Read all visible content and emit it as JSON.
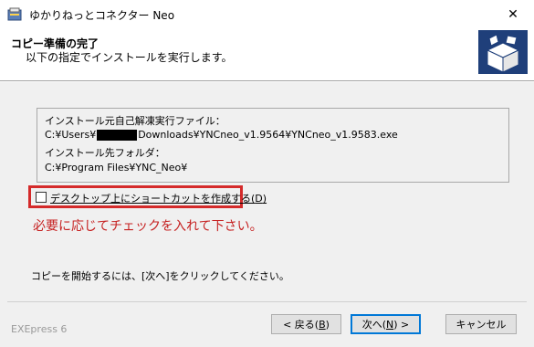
{
  "window": {
    "title": "ゆかりねっとコネクター Neo",
    "close_glyph": "✕"
  },
  "header": {
    "title": "コピー準備の完了",
    "subtitle": "以下の指定でインストールを実行します。"
  },
  "info": {
    "source_label": "インストール元自己解凍実行ファイル：",
    "source_path_prefix": "C:¥Users¥",
    "source_path_suffix": "Downloads¥YNCneo_v1.9564¥YNCneo_v1.9583.exe",
    "dest_label": "インストール先フォルダ：",
    "dest_path": "C:¥Program Files¥YNC_Neo¥"
  },
  "shortcut_option": {
    "label_main": "デスクトップ上にショートカットを作成する(",
    "label_key": "D",
    "label_close": ")",
    "checked": false
  },
  "annotation_text": "必要に応じてチェックを入れて下さい。",
  "footer_note": "コピーを開始するには、[次へ]をクリックしてください。",
  "brand": "EXEpress 6",
  "buttons": {
    "back_main": "< 戻る(",
    "back_key": "B",
    "back_close": ")",
    "next_main": "次へ(",
    "next_key": "N",
    "next_close": ") >",
    "cancel": "キャンセル"
  },
  "colors": {
    "highlight_frame": "#d42a2a",
    "annotation": "#c62020",
    "default_button_border": "#0078d7"
  }
}
